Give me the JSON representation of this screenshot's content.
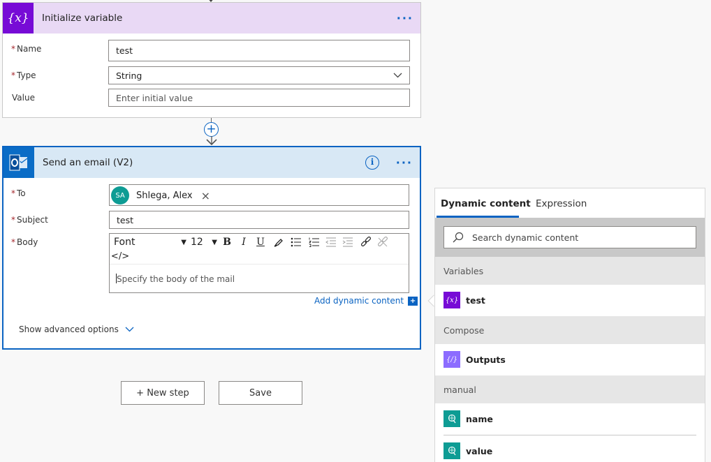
{
  "init_card": {
    "title": "Initialize variable",
    "name_label": "Name",
    "name_value": "test",
    "type_label": "Type",
    "type_value": "String",
    "value_label": "Value",
    "value_placeholder": "Enter initial value"
  },
  "email_card": {
    "title": "Send an email (V2)",
    "to_label": "To",
    "to_token_initials": "SA",
    "to_token_name": "Shlega, Alex",
    "subject_label": "Subject",
    "subject_value": "test",
    "body_label": "Body",
    "font_value": "Font",
    "font_size_value": "12",
    "body_placeholder": "Specify the body of the mail",
    "add_dynamic_label": "Add dynamic content",
    "show_advanced_label": "Show advanced options"
  },
  "buttons": {
    "new_step": "+ New step",
    "save": "Save"
  },
  "dynamic_panel": {
    "tabs": [
      "Dynamic content",
      "Expression"
    ],
    "search_placeholder": "Search dynamic content",
    "sections": [
      {
        "title": "Variables",
        "items": [
          {
            "label": "test",
            "icon": "variable-icon",
            "color": "#770bd6"
          }
        ]
      },
      {
        "title": "Compose",
        "items": [
          {
            "label": "Outputs",
            "icon": "compose-icon",
            "color": "#8c6cff"
          }
        ]
      },
      {
        "title": "manual",
        "items": [
          {
            "label": "name",
            "icon": "request-icon",
            "color": "#0e9c94"
          },
          {
            "label": "value",
            "icon": "request-icon",
            "color": "#0e9c94"
          }
        ]
      }
    ]
  },
  "colors": {
    "accent": "#0a63c2",
    "variable_purple": "#770bd6",
    "outlook_blue": "#0a6cc6"
  }
}
